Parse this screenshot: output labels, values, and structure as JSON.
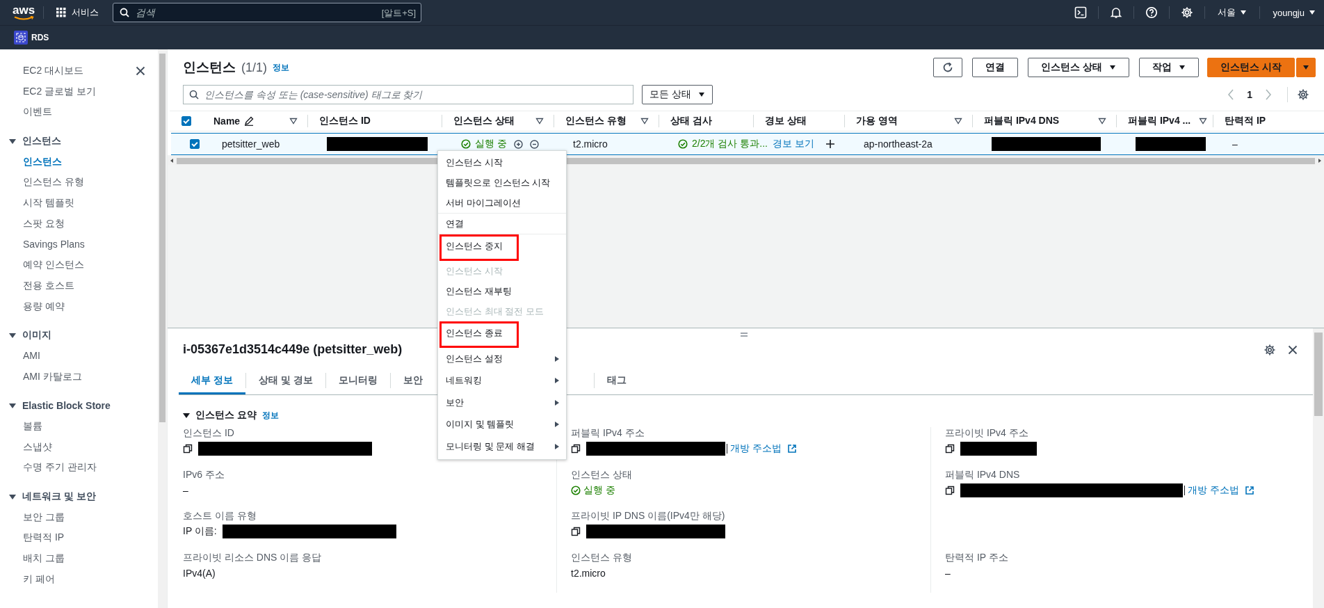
{
  "top_nav": {
    "logo": "aws",
    "services": "서비스",
    "search": {
      "placeholder": "검색",
      "shortcut": "[알트+S]"
    },
    "region": "서울",
    "user": "youngju"
  },
  "favorites": [
    {
      "label": "RDS"
    }
  ],
  "sidebar": {
    "items": [
      {
        "label": "EC2 대시보드",
        "selected": false
      },
      {
        "label": "EC2 글로벌 보기",
        "selected": false
      },
      {
        "label": "이벤트",
        "selected": false
      }
    ],
    "sections": [
      {
        "title": "인스턴스",
        "expanded": true,
        "items": [
          {
            "label": "인스턴스",
            "selected": true
          },
          {
            "label": "인스턴스 유형",
            "selected": false
          },
          {
            "label": "시작 템플릿",
            "selected": false
          },
          {
            "label": "스팟 요청",
            "selected": false
          },
          {
            "label": "Savings Plans",
            "selected": false
          },
          {
            "label": "예약 인스턴스",
            "selected": false
          },
          {
            "label": "전용 호스트",
            "selected": false
          },
          {
            "label": "용량 예약",
            "selected": false
          }
        ]
      },
      {
        "title": "이미지",
        "expanded": true,
        "items": [
          {
            "label": "AMI",
            "selected": false
          },
          {
            "label": "AMI 카탈로그",
            "selected": false
          }
        ]
      },
      {
        "title": "Elastic Block Store",
        "expanded": true,
        "items": [
          {
            "label": "볼륨",
            "selected": false
          },
          {
            "label": "스냅샷",
            "selected": false
          },
          {
            "label": "수명 주기 관리자",
            "selected": false
          }
        ]
      },
      {
        "title": "네트워크 및 보안",
        "expanded": true,
        "items": [
          {
            "label": "보안 그룹",
            "selected": false
          },
          {
            "label": "탄력적 IP",
            "selected": false
          },
          {
            "label": "배치 그룹",
            "selected": false
          },
          {
            "label": "키 페어",
            "selected": false
          }
        ]
      }
    ]
  },
  "instances": {
    "title": "인스턴스",
    "count": "(1/1)",
    "info_link": "정보",
    "buttons": [
      {
        "kind": "refresh"
      },
      {
        "kind": "plain",
        "label": "연결"
      },
      {
        "kind": "dropdown",
        "label": "인스턴스 상태"
      },
      {
        "kind": "dropdown",
        "label": "작업"
      },
      {
        "kind": "primary-split",
        "label": "인스턴스 시작"
      }
    ],
    "search": {
      "placeholder": "인스턴스를 속성 또는 (case-sensitive) 태그로 찾기"
    },
    "state_filter": "모든 상태",
    "page": "1"
  },
  "table": {
    "all_checked": true,
    "columns": [
      {
        "label": "Name",
        "filter": true,
        "editable": true
      },
      {
        "label": "인스턴스 ID",
        "filter": false,
        "editable": false
      },
      {
        "label": "인스턴스 상태",
        "filter": true,
        "editable": false
      },
      {
        "label": "인스턴스 유형",
        "filter": true,
        "editable": false
      },
      {
        "label": "상태 검사",
        "filter": false,
        "editable": false
      },
      {
        "label": "경보 상태",
        "filter": false,
        "editable": false
      },
      {
        "label": "가용 영역",
        "filter": true,
        "editable": false
      },
      {
        "label": "퍼블릭 IPv4 DNS",
        "filter": true,
        "editable": false
      },
      {
        "label": "퍼블릭 IPv4 ...",
        "filter": true,
        "editable": false
      },
      {
        "label": "탄력적 IP",
        "filter": false,
        "editable": false
      }
    ],
    "rows": [
      {
        "checked": true,
        "selected": true,
        "cells": [
          {
            "kind": "text",
            "text": "petsitter_web"
          },
          {
            "kind": "redacted"
          },
          {
            "kind": "status",
            "text": "실행 중"
          },
          {
            "kind": "text",
            "text": "t2.micro"
          },
          {
            "kind": "check",
            "text": "2/2개 검사 통과..."
          },
          {
            "kind": "link-add",
            "text": "경보 보기"
          },
          {
            "kind": "text",
            "text": "ap-northeast-2a"
          },
          {
            "kind": "redacted"
          },
          {
            "kind": "redacted"
          },
          {
            "kind": "text",
            "text": "–"
          }
        ]
      }
    ]
  },
  "context_menu": {
    "groups": [
      [
        {
          "label": "인스턴스 시작",
          "disabled": false,
          "submenu": false,
          "marked": false
        },
        {
          "label": "템플릿으로 인스턴스 시작",
          "disabled": false,
          "submenu": false,
          "marked": false
        },
        {
          "label": "서버 마이그레이션",
          "disabled": false,
          "submenu": false,
          "marked": false
        }
      ],
      [
        {
          "label": "연결",
          "disabled": false,
          "submenu": false,
          "marked": false
        }
      ],
      [
        {
          "label": "인스턴스 중지",
          "disabled": false,
          "submenu": false,
          "marked": true
        },
        {
          "label": "인스턴스 시작",
          "disabled": true,
          "submenu": false,
          "marked": false
        },
        {
          "label": "인스턴스 재부팅",
          "disabled": false,
          "submenu": false,
          "marked": false
        },
        {
          "label": "인스턴스 최대 절전 모드",
          "disabled": true,
          "submenu": false,
          "marked": false
        },
        {
          "label": "인스턴스 종료",
          "disabled": false,
          "submenu": false,
          "marked": true
        },
        {
          "label": "인스턴스 설정",
          "disabled": false,
          "submenu": true,
          "marked": false
        },
        {
          "label": "네트워킹",
          "disabled": false,
          "submenu": true,
          "marked": false
        },
        {
          "label": "보안",
          "disabled": false,
          "submenu": true,
          "marked": false
        },
        {
          "label": "이미지 및 템플릿",
          "disabled": false,
          "submenu": true,
          "marked": false
        },
        {
          "label": "모니터링 및 문제 해결",
          "disabled": false,
          "submenu": true,
          "marked": false
        }
      ]
    ]
  },
  "detail": {
    "title": "i-05367e1d3514c449e (petsitter_web)",
    "tabs": [
      {
        "label": "세부 정보",
        "selected": true
      },
      {
        "label": "상태 및 경보",
        "selected": false
      },
      {
        "label": "모니터링",
        "selected": false
      },
      {
        "label": "보안",
        "selected": false
      },
      {
        "label": "태그",
        "selected": false
      }
    ],
    "section": {
      "title": "인스턴스 요약",
      "expanded": true,
      "info_link": "정보"
    },
    "rows": [
      [
        {
          "label": "인스턴스 ID",
          "copy": true,
          "redacted": true
        },
        {
          "label": "퍼블릭 IPv4 주소",
          "copy": true,
          "redacted": true,
          "link": "개방 주소법"
        },
        {
          "label": "프라이빗 IPv4 주소",
          "copy": true,
          "redacted": true
        }
      ],
      [
        {
          "label": "IPv6 주소",
          "value": "–"
        },
        {
          "label": "인스턴스 상태",
          "value": "실행 중",
          "ok": true
        },
        {
          "label": "퍼블릭 IPv4 DNS",
          "copy": true,
          "redacted": true,
          "link": "개방 주소법"
        }
      ],
      [
        {
          "label": "호스트 이름 유형",
          "value": "IP 이름:",
          "redacted": true
        },
        {
          "label": "프라이빗 IP DNS 이름(IPv4만 해당)",
          "copy": true,
          "redacted": true
        }
      ],
      [
        {
          "label": "프라이빗 리소스 DNS 이름 응답",
          "value": "IPv4(A)"
        },
        {
          "label": "인스턴스 유형",
          "value": "t2.micro"
        },
        {
          "label": "탄력적 IP 주소",
          "value": "–"
        }
      ]
    ]
  }
}
